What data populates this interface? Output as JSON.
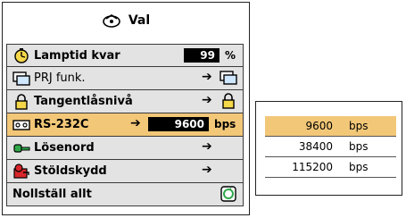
{
  "menu": {
    "title": "Val",
    "title_icon": "gear-menu-icon",
    "rows": [
      {
        "label": "Lamptid kvar",
        "icon": "lamp-timer-icon",
        "value": "99",
        "unit": "%"
      },
      {
        "label": "PRJ funk.",
        "icon": "projector-mode-icon"
      },
      {
        "label": "Tangentlåsnivå",
        "icon": "padlock-icon"
      },
      {
        "label": "RS-232C",
        "icon": "serial-port-icon",
        "value": "9600",
        "unit": "bps"
      },
      {
        "label": "Lösenord",
        "icon": "key-icon"
      },
      {
        "label": "Stöldskydd",
        "icon": "anti-theft-icon"
      },
      {
        "label": "Nollställ allt",
        "icon": "reset-icon"
      }
    ],
    "arrow": "➔"
  },
  "popup": {
    "options": [
      {
        "value": "9600",
        "unit": "bps"
      },
      {
        "value": "38400",
        "unit": "bps"
      },
      {
        "value": "115200",
        "unit": "bps"
      }
    ]
  },
  "colors": {
    "row_bg": "#e3e3e3",
    "selected_bg": "#f2c778",
    "value_bg": "#000000"
  }
}
